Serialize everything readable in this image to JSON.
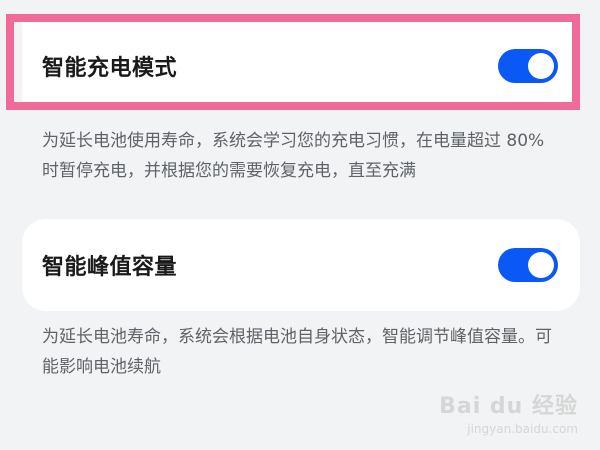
{
  "settings": [
    {
      "label": "智能充电模式",
      "enabled": true,
      "description": "为延长电池使用寿命，系统会学习您的充电习惯，在电量超过 80% 时暂停充电，并根据您的需要恢复充电，直至充满"
    },
    {
      "label": "智能峰值容量",
      "enabled": true,
      "description": "为延长电池寿命，系统会根据电池自身状态，智能调节峰值容量。可能影响电池续航"
    }
  ],
  "watermark": {
    "logo": "Bai du 经验",
    "url": "jingyan.baidu.com"
  },
  "colors": {
    "toggle_on": "#0a59f7",
    "highlight": "#f06b98",
    "background": "#f1f3f5"
  }
}
